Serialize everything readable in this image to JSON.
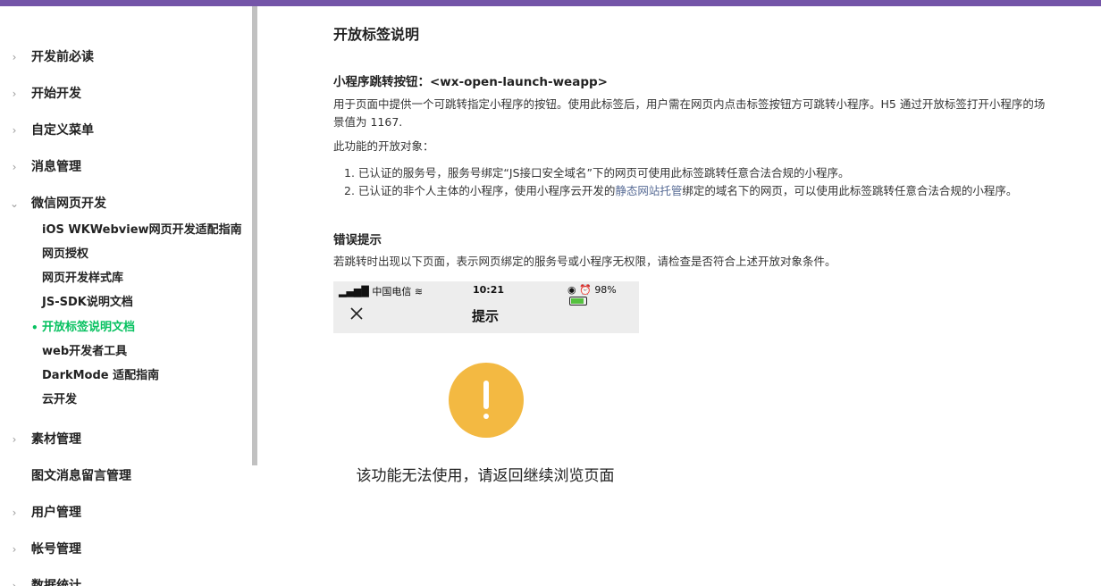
{
  "sidebar": {
    "items": [
      {
        "label": "开发前必读",
        "chevron": "chevron-right-icon"
      },
      {
        "label": "开始开发",
        "chevron": "chevron-right-icon"
      },
      {
        "label": "自定义菜单",
        "chevron": "chevron-right-icon"
      },
      {
        "label": "消息管理",
        "chevron": "chevron-right-icon"
      },
      {
        "label": "微信网页开发",
        "chevron": "chevron-down-icon"
      },
      {
        "label": "素材管理",
        "chevron": "chevron-right-icon"
      },
      {
        "label": "图文消息留言管理",
        "chevron": ""
      },
      {
        "label": "用户管理",
        "chevron": "chevron-right-icon"
      },
      {
        "label": "帐号管理",
        "chevron": "chevron-right-icon"
      },
      {
        "label": "数据统计",
        "chevron": "chevron-right-icon"
      }
    ],
    "subitems": [
      {
        "label": "iOS WKWebview网页开发适配指南"
      },
      {
        "label": "网页授权"
      },
      {
        "label": "网页开发样式库"
      },
      {
        "label": "JS-SDK说明文档"
      },
      {
        "label": "开放标签说明文档",
        "active": true
      },
      {
        "label": "web开发者工具"
      },
      {
        "label": "DarkMode 适配指南"
      },
      {
        "label": "云开发"
      }
    ],
    "active_color": "#07c160"
  },
  "content": {
    "title": "开放标签说明",
    "section1_heading": "小程序跳转按钮：<wx-open-launch-weapp>",
    "section1_desc": "用于页面中提供一个可跳转指定小程序的按钮。使用此标签后，用户需在网页内点击标签按钮方可跳转小程序。H5 通过开放标签打开小程序的场景值为 1167.",
    "open_targets_label": "此功能的开放对象：",
    "list1": "1. 已认证的服务号，服务号绑定“JS接口安全域名”下的网页可使用此标签跳转任意合法合规的小程序。",
    "list2_prefix": "2. 已认证的非个人主体的小程序，使用小程序云开发的",
    "list2_link": "静态网站托管",
    "list2_suffix": "绑定的域名下的网页，可以使用此标签跳转任意合法合规的小程序。",
    "section2_heading": "错误提示",
    "section2_desc": "若跳转时出现以下页面，表示网页绑定的服务号或小程序无权限，请检查是否符合上述开放对象条件。"
  },
  "screenshot": {
    "status_left": "中国电信",
    "status_time": "10:21",
    "status_battery": "98%",
    "nav_title": "提示",
    "warning_text": "该功能无法使用，请返回继续浏览页面",
    "warning_color": "#f3b942"
  }
}
